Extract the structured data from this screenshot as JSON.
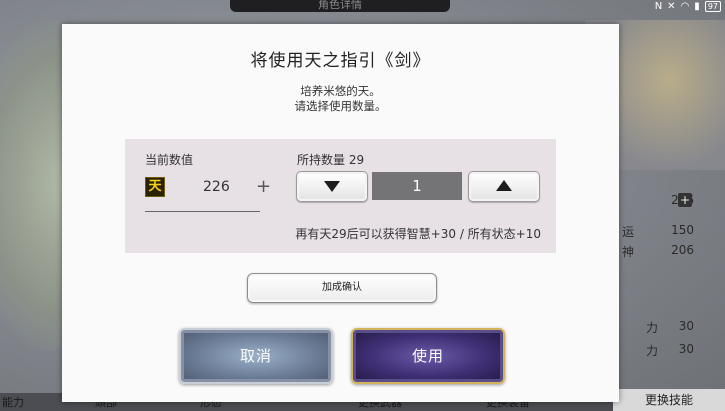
{
  "background": {
    "screen_title": "角色详情",
    "stats": [
      {
        "label": "",
        "value": "226"
      },
      {
        "label": "运",
        "value": "150"
      },
      {
        "label": "神",
        "value": "206"
      },
      {
        "label": "力",
        "value": "30"
      },
      {
        "label": "力",
        "value": "30"
      }
    ],
    "bottom_left": "能力",
    "bottom_items": [
      "頭部",
      "形态",
      "更换武器",
      "更换装备"
    ],
    "skill_button": "更换技能",
    "status_battery": "97"
  },
  "dialog": {
    "title": "将使用天之指引《剑》",
    "desc_line1": "培养米悠的天。",
    "desc_line2": "请选择使用数量。",
    "current_label": "当前数值",
    "item_icon_char": "天",
    "current_value": "226",
    "plus": "+",
    "owned_label": "所持数量 29",
    "quantity": "1",
    "note": "再有天29后可以获得智慧+30 / 所有状态+10",
    "confirm_label": "加成确认",
    "cancel_label": "取消",
    "use_label": "使用"
  }
}
